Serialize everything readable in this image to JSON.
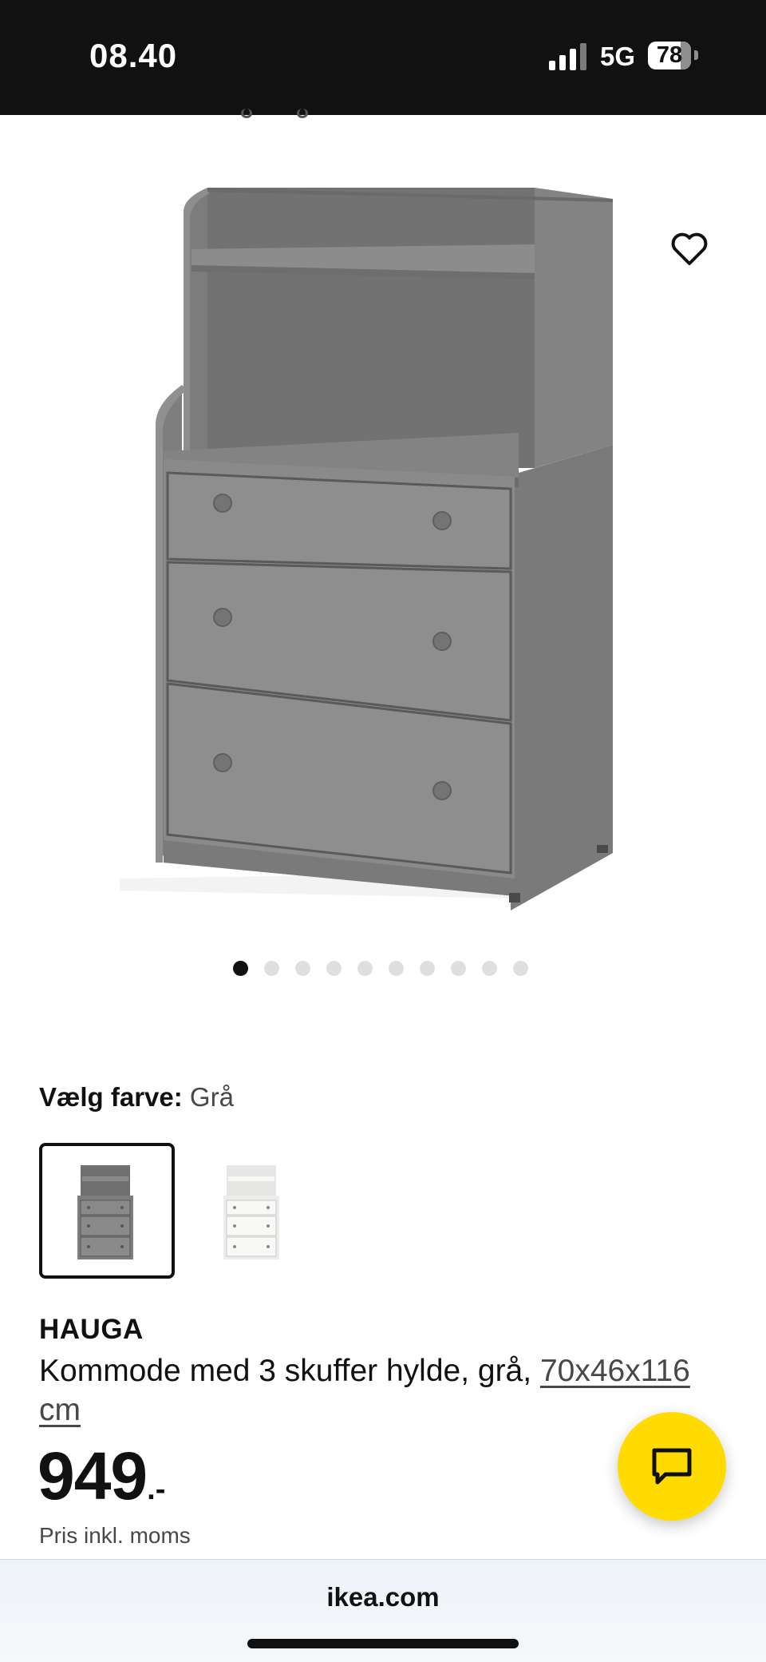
{
  "status_bar": {
    "time": "08.40",
    "network": "5G",
    "battery": "78",
    "signal_icon": "signal-bars-icon",
    "battery_icon": "battery-icon"
  },
  "product_image": {
    "favorite_icon": "heart-outline-icon",
    "gallery_dots": {
      "count": 10,
      "active_index": 0
    }
  },
  "color_picker": {
    "label": "Vælg farve:",
    "selected": "Grå",
    "options": [
      {
        "name": "grey",
        "fill": "#8a8a8a",
        "selected": true
      },
      {
        "name": "white",
        "fill": "#f4f4f2",
        "selected": false
      }
    ]
  },
  "product": {
    "name": "HAUGA",
    "description": "Kommode med 3 skuffer hylde, grå,",
    "size_link": "70x46x116 cm",
    "price_integer": "949",
    "price_suffix": ".-",
    "price_note": "Pris inkl. moms"
  },
  "chat_button": {
    "icon": "chat-bubble-icon",
    "color": "#ffdb00"
  },
  "browser": {
    "url": "ikea.com"
  },
  "colors": {
    "brand_yellow": "#ffdb00",
    "text_primary": "#111111",
    "text_secondary": "#484848"
  }
}
